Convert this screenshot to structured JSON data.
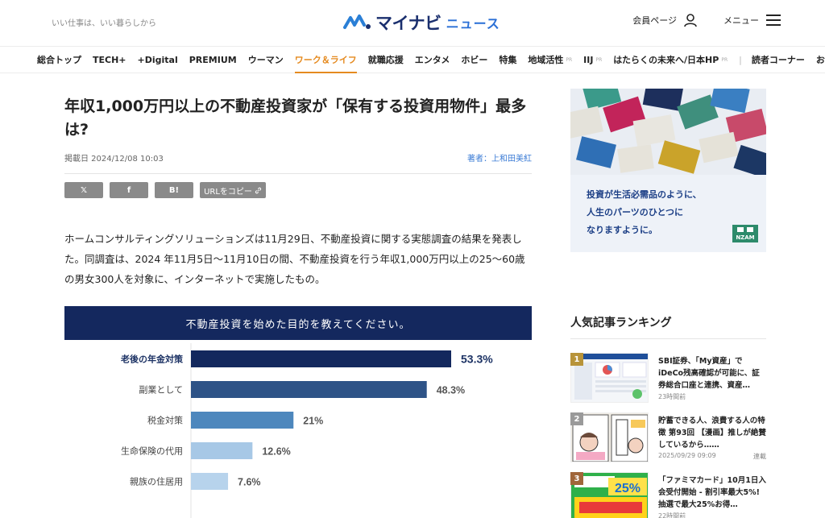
{
  "header": {
    "tagline": "いい仕事は、いい暮らしから",
    "logo_main": "マイナビ",
    "logo_sub": "ニュース",
    "member_label": "会員ページ",
    "menu_label": "メニュー"
  },
  "nav": {
    "items": [
      {
        "label": "総合トップ",
        "active": false
      },
      {
        "label": "TECH+",
        "active": false
      },
      {
        "label": "+Digital",
        "active": false
      },
      {
        "label": "PREMIUM",
        "active": false
      },
      {
        "label": "ウーマン",
        "active": false
      },
      {
        "label": "ワーク＆ライフ",
        "active": true
      },
      {
        "label": "就職応援",
        "active": false
      },
      {
        "label": "エンタメ",
        "active": false
      },
      {
        "label": "ホビー",
        "active": false
      },
      {
        "label": "特集",
        "active": false
      },
      {
        "label": "地域活性",
        "active": false,
        "pr": "PR"
      },
      {
        "label": "IIJ",
        "active": false,
        "pr": "PR"
      },
      {
        "label": "はたらくの未来へ/日本HP",
        "active": false,
        "pr": "PR"
      },
      {
        "label": "読者コーナー",
        "active": false
      },
      {
        "label": "おすすめ",
        "active": false
      }
    ],
    "separator": "|"
  },
  "article": {
    "title": "年収1,000万円以上の不動産投資家が「保有する投資用物件」最多は?",
    "date": "掲載日 2024/12/08 10:03",
    "author": "著者：上和田美紅",
    "share": {
      "x": "𝕏",
      "facebook": "f",
      "hatena": "B!",
      "url_copy": "URLをコピー"
    },
    "body": "ホームコンサルティングソリューションズは11月29日、不動産投資に関する実態調査の結果を発表した。同調査は、2024 年11月5日〜11月10日の間、不動産投資を行う年収1,000万円以上の25〜60歳の男女300人を対象に、インターネットで実施したもの。"
  },
  "chart_data": {
    "type": "bar",
    "orientation": "horizontal",
    "title": "不動産投資を始めた目的を教えてください。",
    "categories": [
      "老後の年金対策",
      "副業として",
      "税金対策",
      "生命保険の代用",
      "親族の住居用"
    ],
    "values": [
      53.3,
      48.3,
      21,
      12.6,
      7.6
    ],
    "value_labels": [
      "53.3%",
      "48.3%",
      "21%",
      "12.6%",
      "7.6%"
    ],
    "colors": [
      "#13285d",
      "#2e5387",
      "#4d87bd",
      "#a7c8e6",
      "#b7d3ec"
    ],
    "xlim": [
      0,
      100
    ],
    "grid": false
  },
  "sidebar": {
    "ad": {
      "line1": "投資が生活必需品のように、",
      "line2": "人生のパーツのひとつに",
      "line3": "なりますように。",
      "brand": "NZAM"
    },
    "ranking": {
      "title": "人気記事ランキング",
      "items": [
        {
          "rank": "1",
          "title": "SBI証券、「My資産」でiDeCo残高確認が可能に、証券総合口座と連携、資産…",
          "time": "23時間前",
          "tag": ""
        },
        {
          "rank": "2",
          "title": "貯蓄できる人、浪費する人の特徴 第93回 【漫画】推しが絶賛しているから……",
          "time": "2025/09/29 09:09",
          "tag": "連載"
        },
        {
          "rank": "3",
          "title": "「ファミマカード」10月1日入会受付開始 - 割引率最大5%! 抽選で最大25%お得…",
          "time": "22時間前",
          "tag": ""
        }
      ]
    }
  },
  "colors": {
    "accent": "#e58a1f",
    "navy": "#14285e",
    "link": "#3a7bd5"
  }
}
